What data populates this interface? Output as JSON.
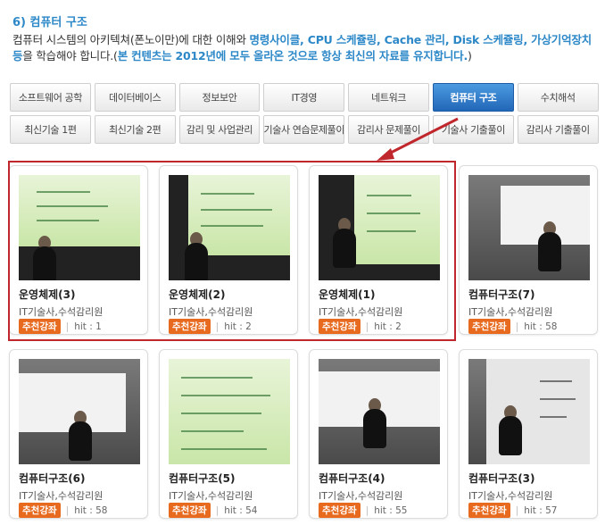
{
  "heading": "6) 컴퓨터 구조",
  "description": {
    "part1": "컴퓨터 시스템의 아키텍쳐(폰노이만)에 대한 이해와 ",
    "highlight1": "명령사이클, CPU 스케쥴링, Cache 관리, Disk 스케쥴링, 가상기억장치 등",
    "part2": "을 학습해야 합니다.(",
    "highlight2": "본 컨텐츠는 2012년에 모두 올라온 것으로 항상 최신의 자료를 유지합니다.",
    "part3": ")"
  },
  "tabs": {
    "row1": [
      "소프트웨어 공학",
      "데이터베이스",
      "정보보안",
      "IT경영",
      "네트워크",
      "컴퓨터 구조",
      "수치해석"
    ],
    "row2": [
      "최신기술 1편",
      "최신기술 2편",
      "감리 및 사업관리",
      "기술사 연습문제풀이",
      "감리사 문제풀이",
      "기술사 기출풀이",
      "감리사 기출풀이"
    ],
    "active": "컴퓨터 구조"
  },
  "courses": [
    {
      "title": "운영체제(3)",
      "author": "IT기술사,수석감리원",
      "badge": "추천강좌",
      "hit": "hit : 1"
    },
    {
      "title": "운영체제(2)",
      "author": "IT기술사,수석감리원",
      "badge": "추천강좌",
      "hit": "hit : 2"
    },
    {
      "title": "운영체제(1)",
      "author": "IT기술사,수석감리원",
      "badge": "추천강좌",
      "hit": "hit : 2"
    },
    {
      "title": "컴퓨터구조(7)",
      "author": "IT기술사,수석감리원",
      "badge": "추천강좌",
      "hit": "hit : 58"
    },
    {
      "title": "컴퓨터구조(6)",
      "author": "IT기술사,수석감리원",
      "badge": "추천강좌",
      "hit": "hit : 58"
    },
    {
      "title": "컴퓨터구조(5)",
      "author": "IT기술사,수석감리원",
      "badge": "추천강좌",
      "hit": "hit : 54"
    },
    {
      "title": "컴퓨터구조(4)",
      "author": "IT기술사,수석감리원",
      "badge": "추천강좌",
      "hit": "hit : 55"
    },
    {
      "title": "컴퓨터구조(3)",
      "author": "IT기술사,수석감리원",
      "badge": "추천강좌",
      "hit": "hit : 57"
    }
  ],
  "colors": {
    "accent": "#2d88c8",
    "badge": "#e76a1f",
    "highlight_border": "#c0272d",
    "active_tab": "#2a72c4"
  }
}
